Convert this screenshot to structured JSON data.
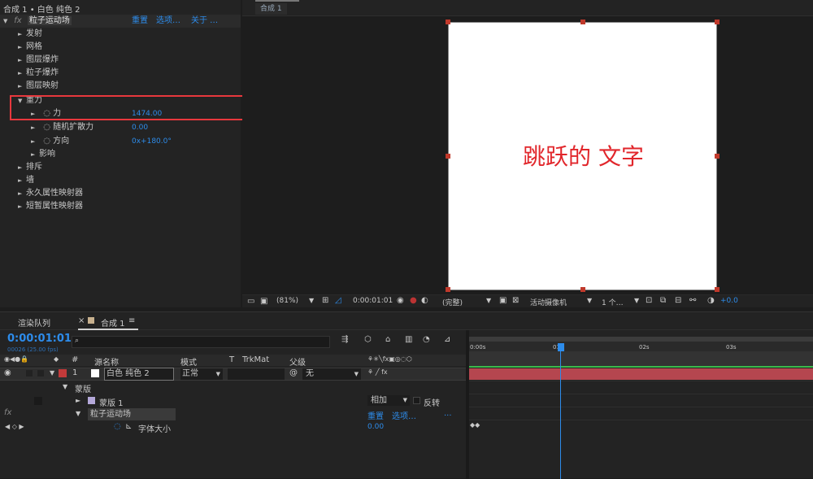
{
  "effects_panel": {
    "title": "合成 1 • 白色 纯色 2",
    "effect_name": "粒子运动场",
    "reset": "重置",
    "options": "选项…",
    "about": "关于 …",
    "items": [
      {
        "label": "发射"
      },
      {
        "label": "网格"
      },
      {
        "label": "图层爆炸"
      },
      {
        "label": "粒子爆炸"
      },
      {
        "label": "图层映射"
      }
    ],
    "gravity": {
      "label": "重力",
      "force_label": "力",
      "force_value": "1474.00",
      "randomness_label": "随机扩散力",
      "randomness_value": "0.00",
      "direction_label": "方向",
      "direction_value": "0x+180.0°",
      "affects_label": "影响"
    },
    "items2": [
      {
        "label": "排斥"
      },
      {
        "label": "墙"
      },
      {
        "label": "永久属性映射器"
      },
      {
        "label": "短暂属性映射器"
      }
    ]
  },
  "viewer": {
    "tab": "合成 1",
    "canvas_text": "跳跃的 文字",
    "zoom": "(81%)",
    "timecode": "0:00:01:01",
    "resolution": "(完整)",
    "camera": "活动摄像机",
    "views": "1 个…",
    "exposure": "+0.0"
  },
  "timeline": {
    "render_queue_tab": "渲染队列",
    "comp_tab": "合成 1",
    "timecode": "0:00:01:01",
    "frames": "00026 (25.00 fps)",
    "search_placeholder": "",
    "cols": {
      "num": "#",
      "source": "源名称",
      "mode": "模式",
      "t": "T",
      "trkmat": "TrkMat",
      "parent": "父级"
    },
    "layer": {
      "num": "1",
      "name": "白色 纯色 2",
      "mode": "正常",
      "parent": "无"
    },
    "mask_group": "蒙版",
    "mask1": "蒙版 1",
    "mask_mode": "相加",
    "invert": "反转",
    "effect": "粒子运动场",
    "reset": "重置",
    "options": "选项…",
    "more": "...",
    "prop_label": "字体大小",
    "prop_value": "0.00",
    "ruler": [
      "0:00s",
      "01s",
      "02s",
      "03s"
    ]
  }
}
